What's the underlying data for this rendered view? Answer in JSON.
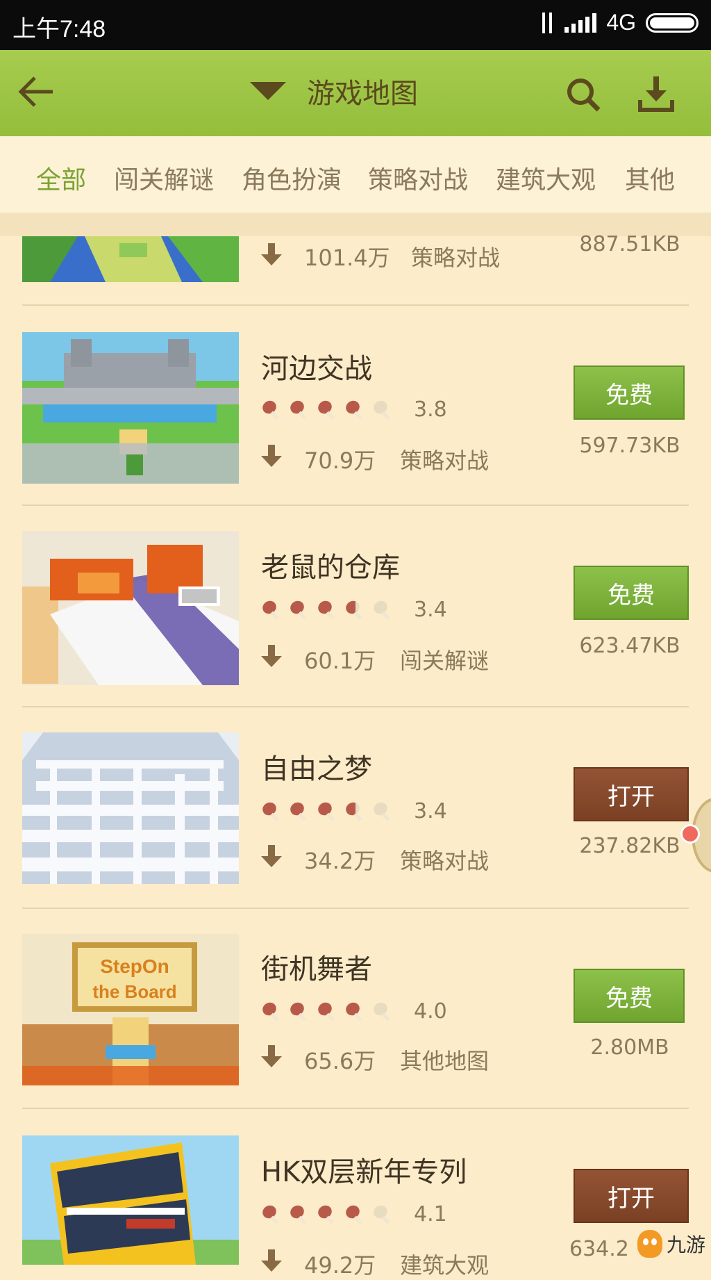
{
  "status_bar": {
    "time": "上午7:48",
    "network": "4G"
  },
  "header": {
    "title": "游戏地图"
  },
  "tabs": [
    {
      "label": "全部",
      "active": true
    },
    {
      "label": "闯关解谜",
      "active": false
    },
    {
      "label": "角色扮演",
      "active": false
    },
    {
      "label": "策略对战",
      "active": false
    },
    {
      "label": "建筑大观",
      "active": false
    },
    {
      "label": "其他",
      "active": false
    }
  ],
  "items": [
    {
      "name": "",
      "rating": null,
      "downloads": "101.4万",
      "category": "策略对战",
      "button": "",
      "size": "887.51KB"
    },
    {
      "name": "河边交战",
      "rating": 3.8,
      "downloads": "70.9万",
      "category": "策略对战",
      "button": "免费",
      "button_type": "free",
      "size": "597.73KB"
    },
    {
      "name": "老鼠的仓库",
      "rating": 3.4,
      "downloads": "60.1万",
      "category": "闯关解谜",
      "button": "免费",
      "button_type": "free",
      "size": "623.47KB"
    },
    {
      "name": "自由之梦",
      "rating": 3.4,
      "downloads": "34.2万",
      "category": "策略对战",
      "button": "打开",
      "button_type": "open",
      "size": "237.82KB"
    },
    {
      "name": "街机舞者",
      "rating": 4.0,
      "downloads": "65.6万",
      "category": "其他地图",
      "button": "免费",
      "button_type": "free",
      "size": "2.80MB"
    },
    {
      "name": "HK双层新年专列",
      "rating": 4.1,
      "downloads": "49.2万",
      "category": "建筑大观",
      "button": "打开",
      "button_type": "open",
      "size": "634.2"
    }
  ],
  "thumbnail_texts": {
    "step_on_board": [
      "StepOn",
      "the Board"
    ]
  },
  "watermark": {
    "text": "九游"
  },
  "colors": {
    "header": "#a7cc4f",
    "background": "#fcecc9",
    "accent_green": "#7aa332",
    "free_button": "#7eb43c",
    "open_button": "#8a4a2c",
    "star_filled": "#b85a4a",
    "star_empty": "#e8dcc0"
  }
}
